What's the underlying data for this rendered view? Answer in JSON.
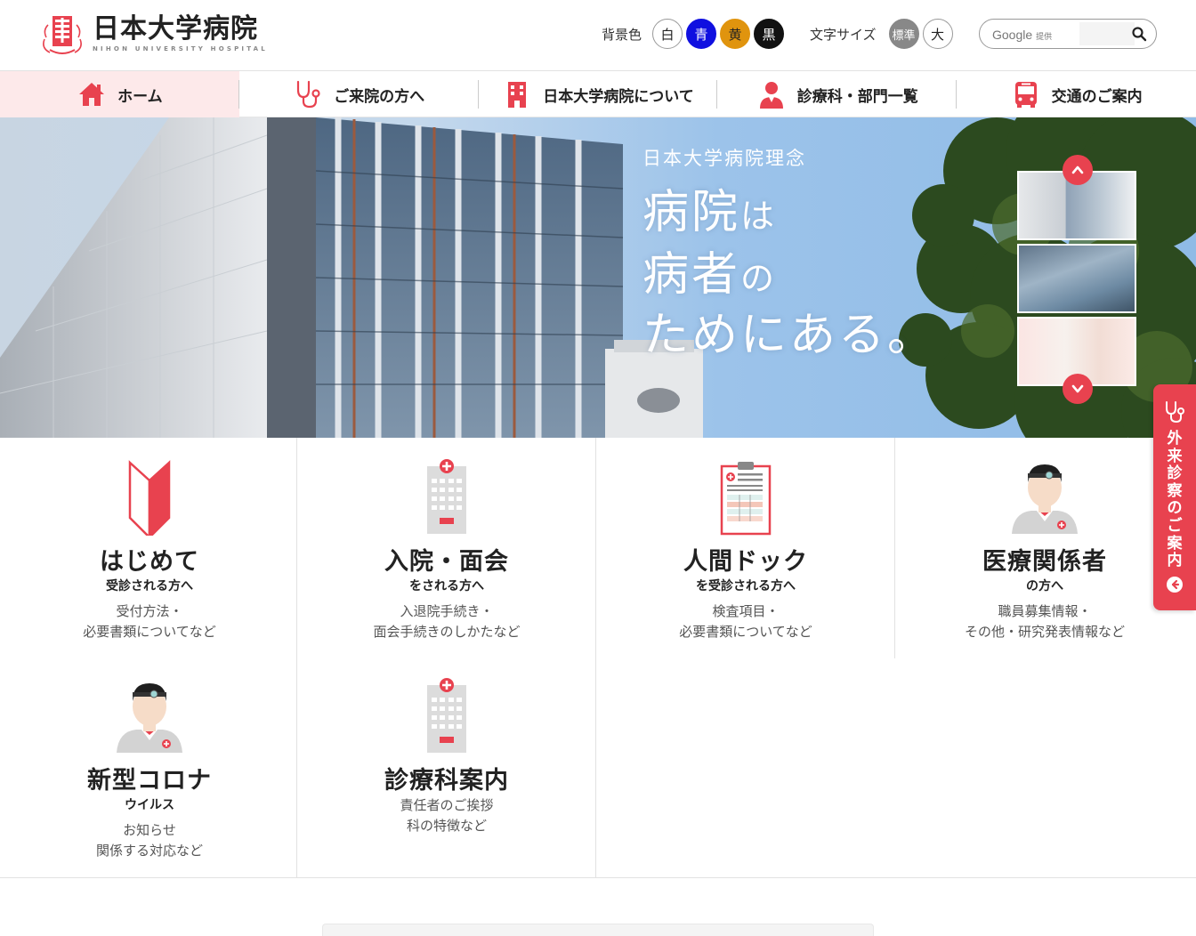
{
  "brand": {
    "name_jp": "日本大学病院",
    "name_en": "NIHON UNIVERSITY HOSPITAL",
    "accent": "#e8424f"
  },
  "utility": {
    "bg_label": "背景色",
    "bg_options": [
      "白",
      "青",
      "黄",
      "黒"
    ],
    "font_label": "文字サイズ",
    "font_options": [
      "標準",
      "大"
    ],
    "search_brand": "Google",
    "search_brand_small": "提供",
    "search_placeholder": ""
  },
  "nav": {
    "items": [
      {
        "label": "ホーム",
        "icon": "home-icon",
        "active": true
      },
      {
        "label": "ご来院の方へ",
        "icon": "stethoscope-icon",
        "active": false
      },
      {
        "label": "日本大学病院について",
        "icon": "building-icon",
        "active": false
      },
      {
        "label": "診療科・部門一覧",
        "icon": "doctor-icon",
        "active": false
      },
      {
        "label": "交通のご案内",
        "icon": "bus-icon",
        "active": false
      }
    ]
  },
  "hero": {
    "subtitle": "日本大学病院理念",
    "line1_big": "病院",
    "line1_small": "は",
    "line2_big": "病者",
    "line2_small": "の",
    "line3": "ためにある。"
  },
  "side_tab": {
    "label": "外来診察のご案内",
    "icon": "stethoscope-icon"
  },
  "cards": [
    {
      "title": "はじめて",
      "sub": "受診される方へ",
      "desc1": "受付方法・",
      "desc2": "必要書類についてなど",
      "icon": "beginner-mark-icon"
    },
    {
      "title": "入院・面会",
      "sub": "をされる方へ",
      "desc1": "入退院手続き・",
      "desc2": "面会手続きのしかたなど",
      "icon": "hospital-building-icon"
    },
    {
      "title": "人間ドック",
      "sub": "を受診される方へ",
      "desc1": "検査項目・",
      "desc2": "必要書類についてなど",
      "icon": "clipboard-icon"
    },
    {
      "title": "医療関係者",
      "sub": "の方へ",
      "desc1": "職員募集情報・",
      "desc2": "その他・研究発表情報など",
      "icon": "medical-staff-icon"
    },
    {
      "title": "新型コロナ",
      "sub": "ウイルス",
      "desc1": "お知らせ",
      "desc2": "関係する対応など",
      "icon": "medical-staff-icon"
    },
    {
      "title": "診療科案内",
      "sub": "",
      "desc1": "責任者のご挨拶",
      "desc2": "科の特徴など",
      "icon": "hospital-building-icon"
    }
  ]
}
